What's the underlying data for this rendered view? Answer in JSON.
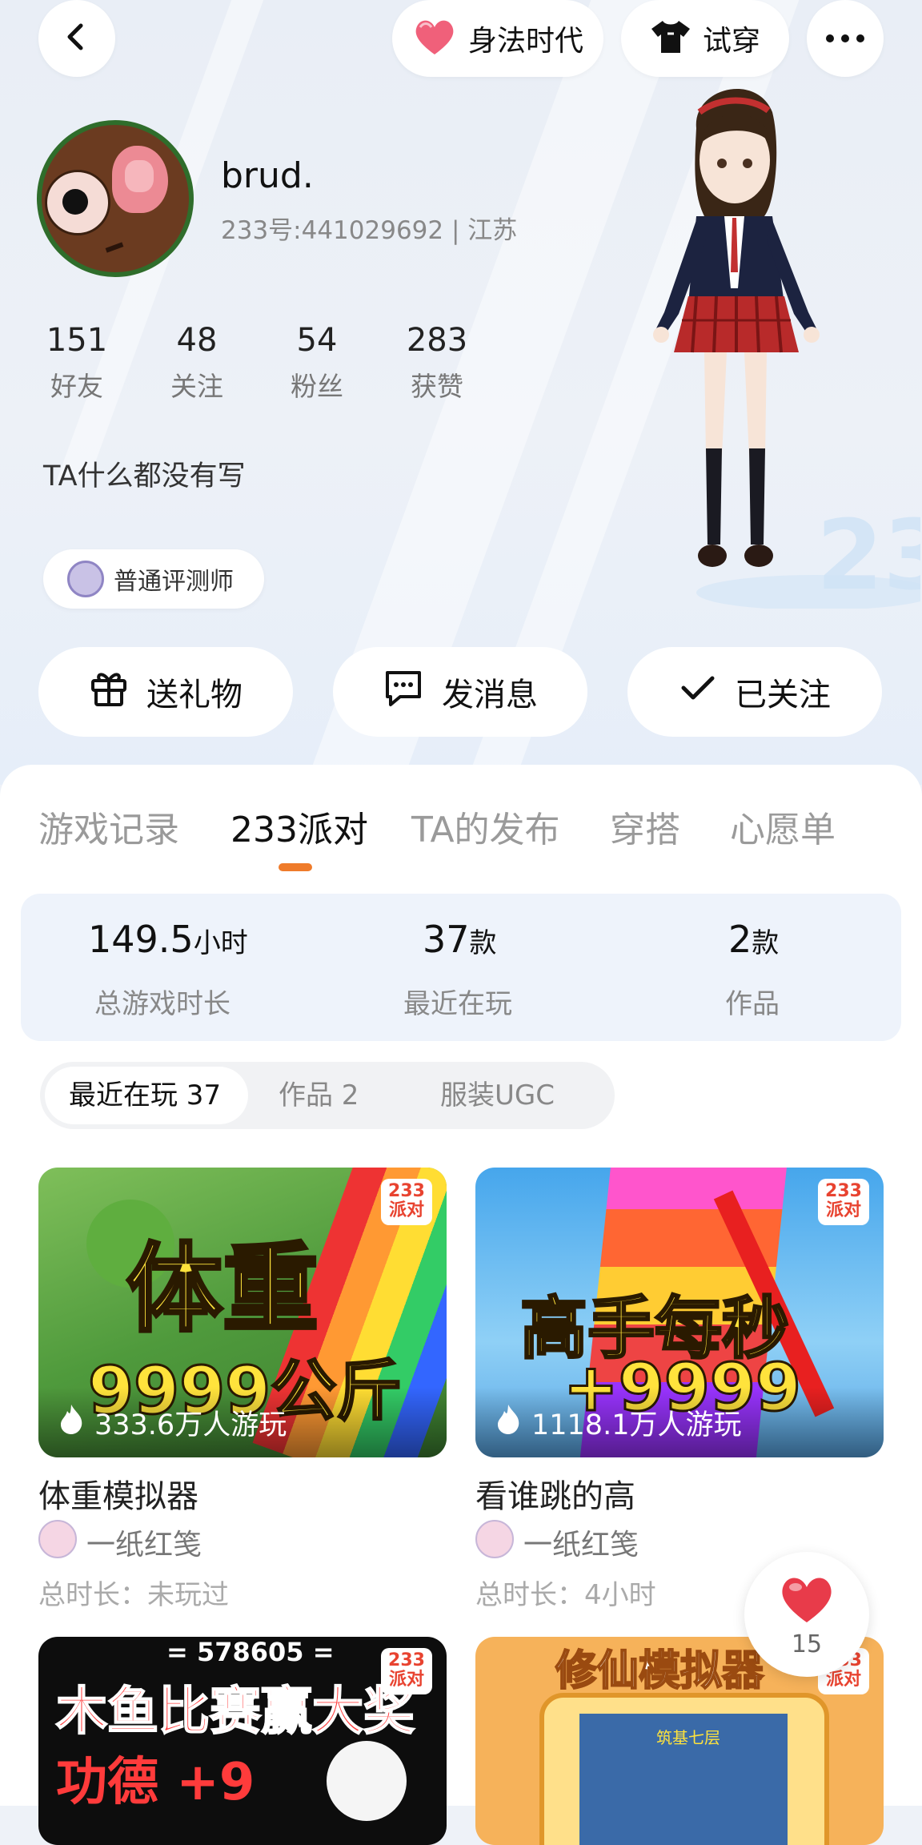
{
  "header": {
    "tag_label": "身法时代",
    "tryon_label": "试穿"
  },
  "profile": {
    "name": "brud.",
    "id_location": "233号:441029692 | 江苏",
    "bio": "TA什么都没有写",
    "badge": "普通评测师",
    "stats": [
      {
        "value": "151",
        "label": "好友"
      },
      {
        "value": "48",
        "label": "关注"
      },
      {
        "value": "54",
        "label": "粉丝"
      },
      {
        "value": "283",
        "label": "获赞"
      }
    ]
  },
  "actions": {
    "gift": "送礼物",
    "message": "发消息",
    "follow": "已关注"
  },
  "tabs": [
    "游戏记录",
    "233派对",
    "TA的发布",
    "穿搭",
    "心愿单"
  ],
  "active_tab": "233派对",
  "summary": [
    {
      "value": "149.5",
      "unit": "小时",
      "label": "总游戏时长"
    },
    {
      "value": "37",
      "unit": "款",
      "label": "最近在玩"
    },
    {
      "value": "2",
      "unit": "款",
      "label": "作品"
    }
  ],
  "segments": [
    "最近在玩 37",
    "作品 2",
    "服装UGC"
  ],
  "games": [
    {
      "title": "体重模拟器",
      "author": "一纸红笺",
      "time": "总时长：未玩过",
      "players": "333.6万人游玩",
      "cover_text": [
        "体重",
        "9999公斤"
      ]
    },
    {
      "title": "看谁跳的高",
      "author": "一纸红笺",
      "time": "总时长：4小时",
      "players": "1118.1万人游玩",
      "cover_text": [
        "高手每秒",
        "+9999"
      ]
    },
    {
      "title": "",
      "author": "",
      "time": "",
      "players": "",
      "cover_text": [
        "= 578605 =",
        "木鱼比赛赢大奖",
        "功德 +9"
      ]
    },
    {
      "title": "",
      "author": "",
      "time": "",
      "players": "",
      "cover_text": [
        "修仙模拟器",
        "筑基七层"
      ]
    }
  ],
  "badge_233": [
    "233",
    "派对"
  ],
  "like_count": "15",
  "colors": {
    "accent": "#ef7b2a",
    "like": "#e83b4a",
    "brand_badge": "#e84330"
  }
}
